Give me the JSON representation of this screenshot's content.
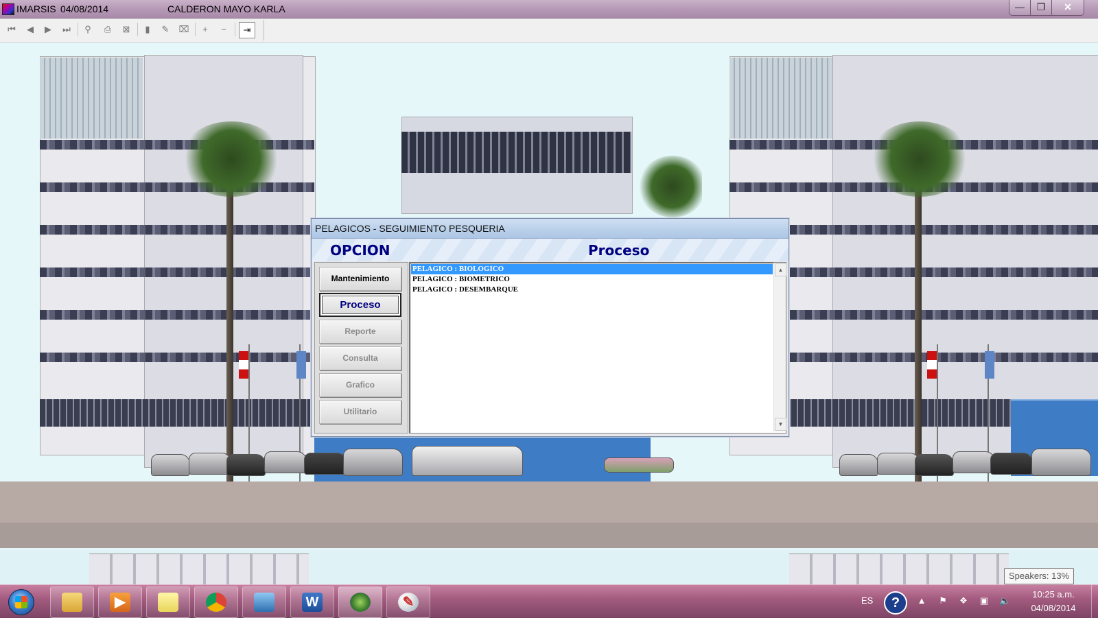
{
  "window": {
    "app_name": "IMARSIS",
    "date": "04/08/2014",
    "user": "CALDERON MAYO KARLA",
    "controls": {
      "minimize": "—",
      "maximize": "❐",
      "close": "✕"
    }
  },
  "toolbar": {
    "icons": [
      "first-record-icon",
      "previous-record-icon",
      "next-record-icon",
      "last-record-icon",
      "find-icon",
      "print-icon",
      "preview-icon",
      "new-icon",
      "edit-icon",
      "delete-icon",
      "add-icon",
      "remove-icon",
      "exit-icon"
    ]
  },
  "dialog": {
    "title": "PELAGICOS - SEGUIMIENTO PESQUERIA",
    "header_left": "OPCION",
    "header_right": "Proceso",
    "menu": [
      {
        "label": "Mantenimiento",
        "state": "enabled"
      },
      {
        "label": "Proceso",
        "state": "active"
      },
      {
        "label": "Reporte",
        "state": "disabled"
      },
      {
        "label": "Consulta",
        "state": "disabled"
      },
      {
        "label": "Grafico",
        "state": "disabled"
      },
      {
        "label": "Utilitario",
        "state": "disabled"
      }
    ],
    "list": [
      {
        "label": "PELAGICO : BIOLOGICO",
        "selected": true
      },
      {
        "label": "PELAGICO : BIOMETRICO",
        "selected": false
      },
      {
        "label": "PELAGICO : DESEMBARQUE",
        "selected": false
      }
    ]
  },
  "taskbar": {
    "apps": [
      "file-explorer-icon",
      "media-player-icon",
      "sticky-notes-icon",
      "chrome-icon",
      "photo-viewer-icon",
      "word-icon",
      "imarsis-icon",
      "paint-icon"
    ],
    "language": "ES",
    "clock_time": "10:25 a.m.",
    "clock_date": "04/08/2014",
    "tooltip": "Speakers: 13%"
  }
}
